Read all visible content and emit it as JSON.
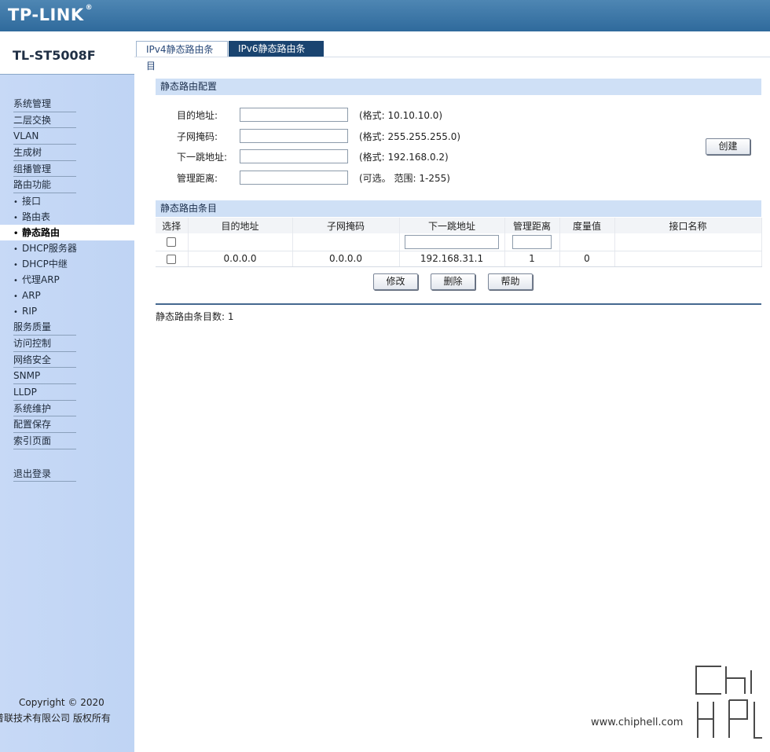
{
  "header": {
    "logo": "TP-LINK",
    "logo_mark": "®"
  },
  "sidebar": {
    "model": "TL-ST5008F",
    "items": [
      {
        "label": "系统管理",
        "type": "top"
      },
      {
        "label": "二层交换",
        "type": "top"
      },
      {
        "label": "VLAN",
        "type": "top"
      },
      {
        "label": "生成树",
        "type": "top"
      },
      {
        "label": "组播管理",
        "type": "top"
      },
      {
        "label": "路由功能",
        "type": "top"
      },
      {
        "label": "接口",
        "type": "sub"
      },
      {
        "label": "路由表",
        "type": "sub"
      },
      {
        "label": "静态路由",
        "type": "sub",
        "active": true
      },
      {
        "label": "DHCP服务器",
        "type": "sub"
      },
      {
        "label": "DHCP中继",
        "type": "sub"
      },
      {
        "label": "代理ARP",
        "type": "sub"
      },
      {
        "label": "ARP",
        "type": "sub"
      },
      {
        "label": "RIP",
        "type": "sub"
      },
      {
        "label": "服务质量",
        "type": "top"
      },
      {
        "label": "访问控制",
        "type": "top"
      },
      {
        "label": "网络安全",
        "type": "top"
      },
      {
        "label": "SNMP",
        "type": "top"
      },
      {
        "label": "LLDP",
        "type": "top"
      },
      {
        "label": "系统维护",
        "type": "top"
      },
      {
        "label": "配置保存",
        "type": "top"
      },
      {
        "label": "索引页面",
        "type": "top"
      }
    ],
    "logout": "退出登录",
    "bullet": "•",
    "copyright_line1": "Copyright © 2020",
    "copyright_line2": "普联技术有限公司 版权所有"
  },
  "tabs": [
    {
      "label": "IPv4静态路由条目",
      "active": true
    },
    {
      "label": "IPv6静态路由条目",
      "active": false
    }
  ],
  "config": {
    "title": "静态路由配置",
    "fields": [
      {
        "label": "目的地址:",
        "value": "",
        "hint": "(格式: 10.10.10.0)"
      },
      {
        "label": "子网掩码:",
        "value": "",
        "hint": "(格式: 255.255.255.0)"
      },
      {
        "label": "下一跳地址:",
        "value": "",
        "hint": "(格式: 192.168.0.2)"
      },
      {
        "label": "管理距离:",
        "value": "",
        "hint": "(可选。 范围: 1-255)"
      }
    ],
    "create_button": "创建"
  },
  "entries": {
    "title": "静态路由条目",
    "columns": [
      "选择",
      "目的地址",
      "子网掩码",
      "下一跳地址",
      "管理距离",
      "度量值",
      "接口名称"
    ],
    "rows": [
      {
        "dest": "0.0.0.0",
        "mask": "0.0.0.0",
        "next_hop": "192.168.31.1",
        "distance": "1",
        "metric": "0",
        "interface": ""
      }
    ],
    "buttons": {
      "modify": "修改",
      "delete": "删除",
      "help": "帮助"
    },
    "count_label": "静态路由条目数:",
    "count_value": "1"
  },
  "watermark": {
    "text": "chip hell",
    "url": "www.chiphell.com"
  }
}
